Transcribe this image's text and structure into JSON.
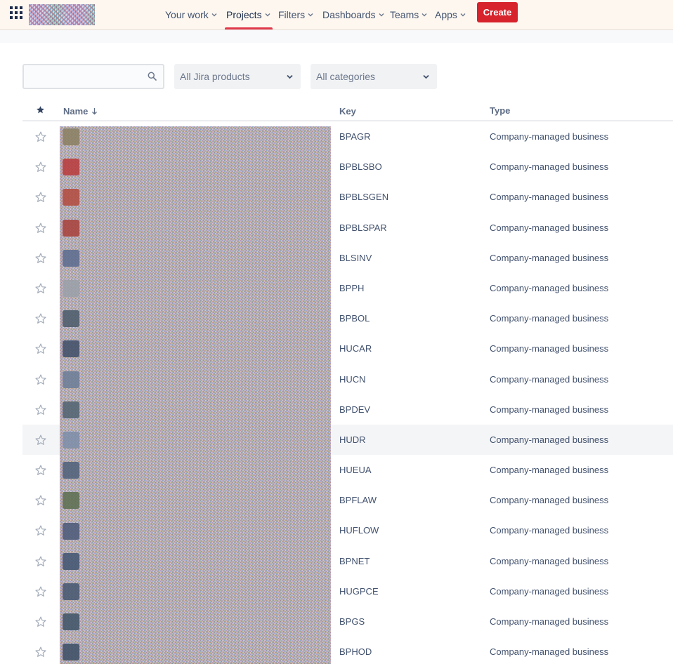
{
  "nav": {
    "items": [
      {
        "label": "Your work"
      },
      {
        "label": "Projects"
      },
      {
        "label": "Filters"
      },
      {
        "label": "Dashboards"
      },
      {
        "label": "Teams"
      },
      {
        "label": "Apps"
      }
    ],
    "active": "Projects",
    "create_label": "Create",
    "accent_color": "#e0384a",
    "create_color": "#d6232c"
  },
  "filters": {
    "search_value": "",
    "search_placeholder": "",
    "product_select": "All Jira products",
    "category_select": "All categories"
  },
  "table": {
    "headers": {
      "name": "Name",
      "key": "Key",
      "type": "Type"
    },
    "sort": "name-desc",
    "rows": [
      {
        "key": "BPAGR",
        "type": "Company-managed business"
      },
      {
        "key": "BPBLSBO",
        "type": "Company-managed business"
      },
      {
        "key": "BPBLSGEN",
        "type": "Company-managed business"
      },
      {
        "key": "BPBLSPAR",
        "type": "Company-managed business"
      },
      {
        "key": "BLSINV",
        "type": "Company-managed business"
      },
      {
        "key": "BPPH",
        "type": "Company-managed business"
      },
      {
        "key": "BPBOL",
        "type": "Company-managed business"
      },
      {
        "key": "HUCAR",
        "type": "Company-managed business"
      },
      {
        "key": "HUCN",
        "type": "Company-managed business"
      },
      {
        "key": "BPDEV",
        "type": "Company-managed business"
      },
      {
        "key": "HUDR",
        "type": "Company-managed business"
      },
      {
        "key": "HUEUA",
        "type": "Company-managed business"
      },
      {
        "key": "BPFLAW",
        "type": "Company-managed business"
      },
      {
        "key": "HUFLOW",
        "type": "Company-managed business"
      },
      {
        "key": "BPNET",
        "type": "Company-managed business"
      },
      {
        "key": "HUGPCE",
        "type": "Company-managed business"
      },
      {
        "key": "BPGS",
        "type": "Company-managed business"
      },
      {
        "key": "BPHOD",
        "type": "Company-managed business"
      }
    ],
    "hover_row_key": "HUDR"
  }
}
